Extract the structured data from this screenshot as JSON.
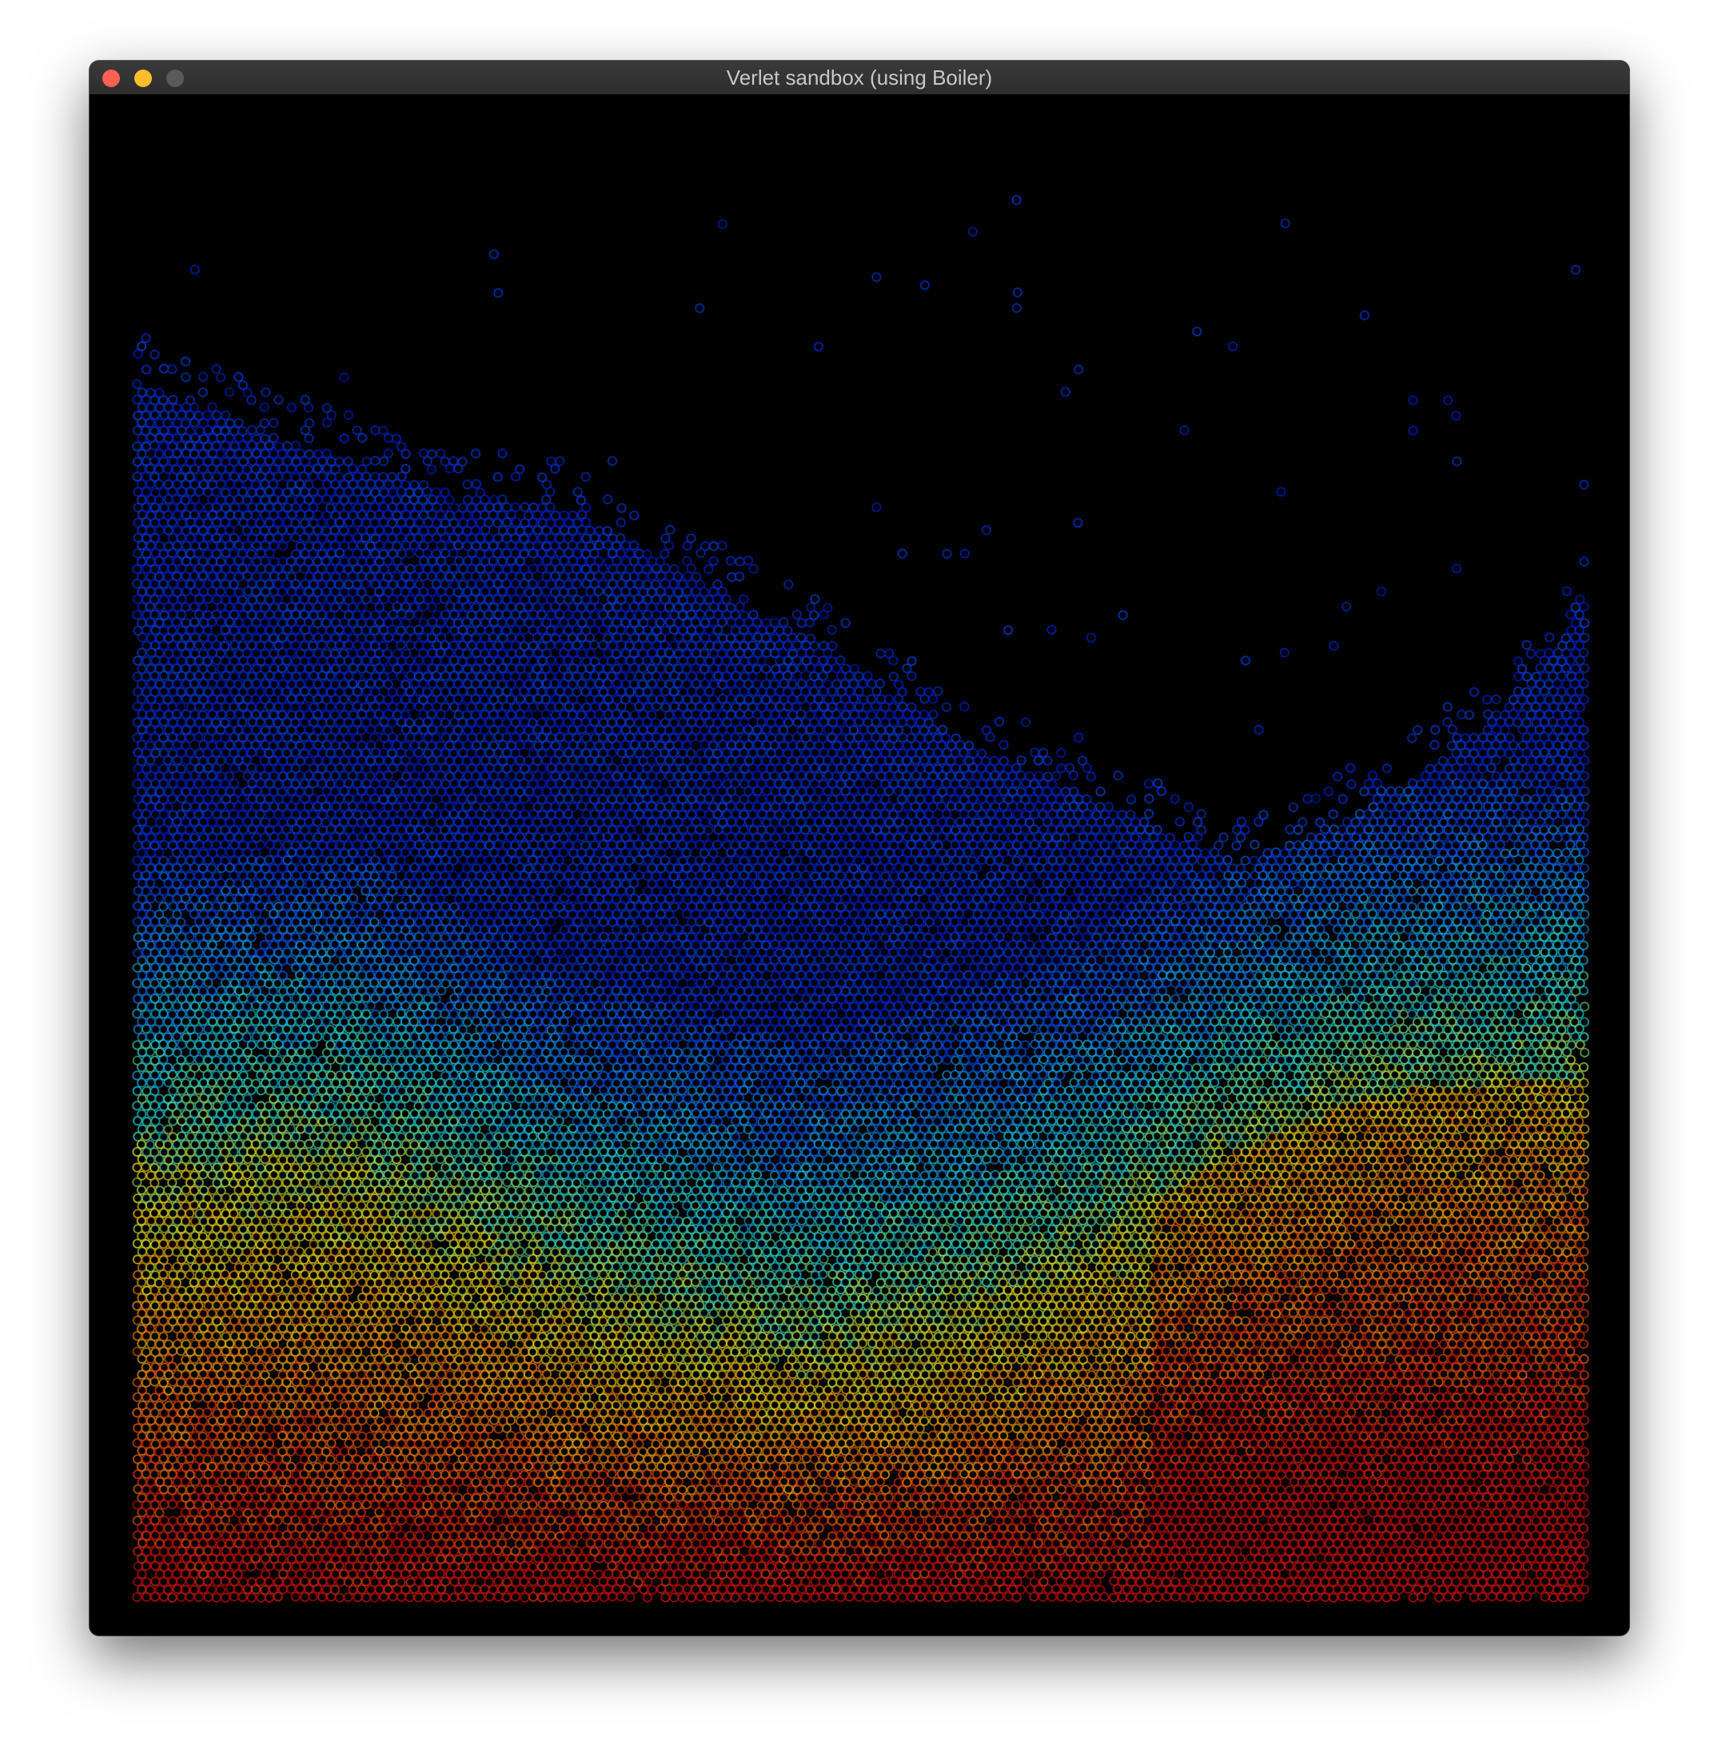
{
  "window": {
    "title": "Verlet sandbox (using Boiler)",
    "background": "#000000",
    "buttons": {
      "close_color": "#fe5f57",
      "minimize_color": "#febc2e",
      "maximize_color": "#5a5a5a"
    }
  },
  "simulation": {
    "particle_style": "outlined circles",
    "colormap": [
      "#0010c8",
      "#0a5af0",
      "#1fd6d6",
      "#e6e61a",
      "#f07a10",
      "#d01010"
    ],
    "colormap_order": "top (blue) to bottom (red)"
  }
}
